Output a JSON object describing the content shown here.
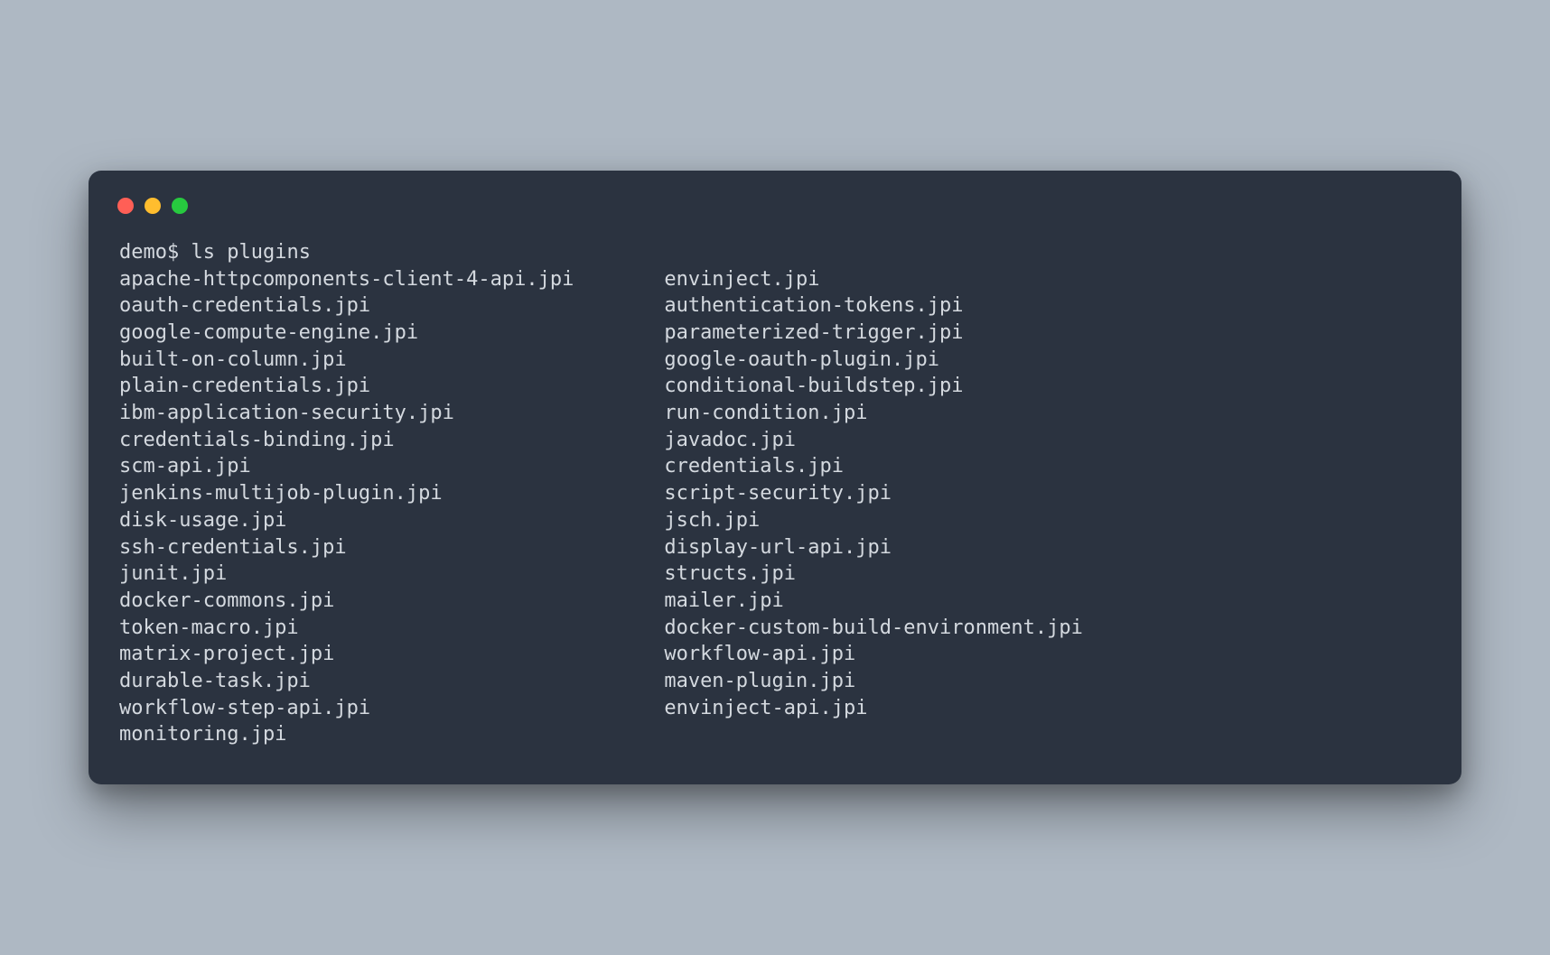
{
  "prompt": "demo$ ",
  "command": "ls plugins",
  "columns": [
    [
      "apache-httpcomponents-client-4-api.jpi",
      "oauth-credentials.jpi",
      "google-compute-engine.jpi",
      "built-on-column.jpi",
      "plain-credentials.jpi",
      "ibm-application-security.jpi",
      "credentials-binding.jpi",
      "scm-api.jpi",
      "jenkins-multijob-plugin.jpi",
      "disk-usage.jpi",
      "ssh-credentials.jpi",
      "junit.jpi",
      "docker-commons.jpi",
      "token-macro.jpi",
      "matrix-project.jpi",
      "durable-task.jpi",
      "workflow-step-api.jpi",
      "monitoring.jpi"
    ],
    [
      "envinject.jpi",
      "authentication-tokens.jpi",
      "parameterized-trigger.jpi",
      "google-oauth-plugin.jpi",
      "conditional-buildstep.jpi",
      "run-condition.jpi",
      "javadoc.jpi",
      "credentials.jpi",
      "script-security.jpi",
      "jsch.jpi",
      "display-url-api.jpi",
      "structs.jpi",
      "mailer.jpi",
      "docker-custom-build-environment.jpi",
      "workflow-api.jpi",
      "maven-plugin.jpi",
      "envinject-api.jpi"
    ]
  ]
}
